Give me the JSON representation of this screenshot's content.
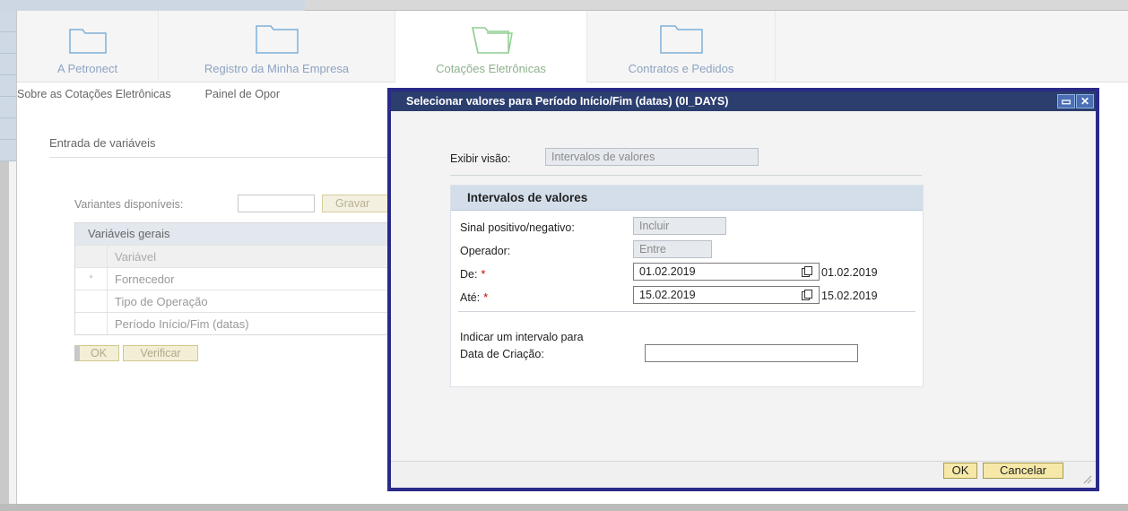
{
  "nav": {
    "items": [
      {
        "label": "A Petronect",
        "active": false
      },
      {
        "label": "Registro da Minha Empresa",
        "active": false
      },
      {
        "label": "Cotações Eletrônicas",
        "active": true
      },
      {
        "label": "Contratos e Pedidos",
        "active": false
      }
    ]
  },
  "subnav": {
    "items": [
      "Sobre as Cotações Eletrônicas",
      "Painel de Opor"
    ]
  },
  "background_panel": {
    "title": "Entrada de variáveis",
    "variants_label": "Variantes disponíveis:",
    "save_button": "Gravar",
    "table_header": "Variáveis gerais",
    "column_header": "Variável",
    "rows": [
      {
        "mark": "*",
        "label": "Fornecedor"
      },
      {
        "mark": "",
        "label": "Tipo de Operação"
      },
      {
        "mark": "",
        "label": "Período Início/Fim (datas)"
      }
    ],
    "ok_button": "OK",
    "verify_button": "Verificar"
  },
  "dialog": {
    "title": "Selecionar valores para Período Início/Fim (datas) (0I_DAYS)",
    "view_label": "Exibir visão:",
    "view_value": "Intervalos de valores",
    "group_title": "Intervalos de valores",
    "sign_label": "Sinal positivo/negativo:",
    "sign_value": "Incluir",
    "operator_label": "Operador:",
    "operator_value": "Entre",
    "from_label": "De:",
    "from_value": "01.02.2019",
    "from_display": "01.02.2019",
    "to_label": "Até:",
    "to_value": "15.02.2019",
    "to_display": "15.02.2019",
    "required_mark": "*",
    "interval_line1": "Indicar um intervalo para",
    "interval_line2": "Data de Criação:",
    "creation_date_value": "",
    "ok_button": "OK",
    "cancel_button": "Cancelar"
  },
  "colors": {
    "dialog_title_bg": "#2b3e6e",
    "dialog_border": "#2a2a88",
    "button_bg": "#f6e9a8",
    "required": "#cc0000",
    "nav_text": "#8da3c2",
    "nav_active_text": "#8db08d"
  }
}
